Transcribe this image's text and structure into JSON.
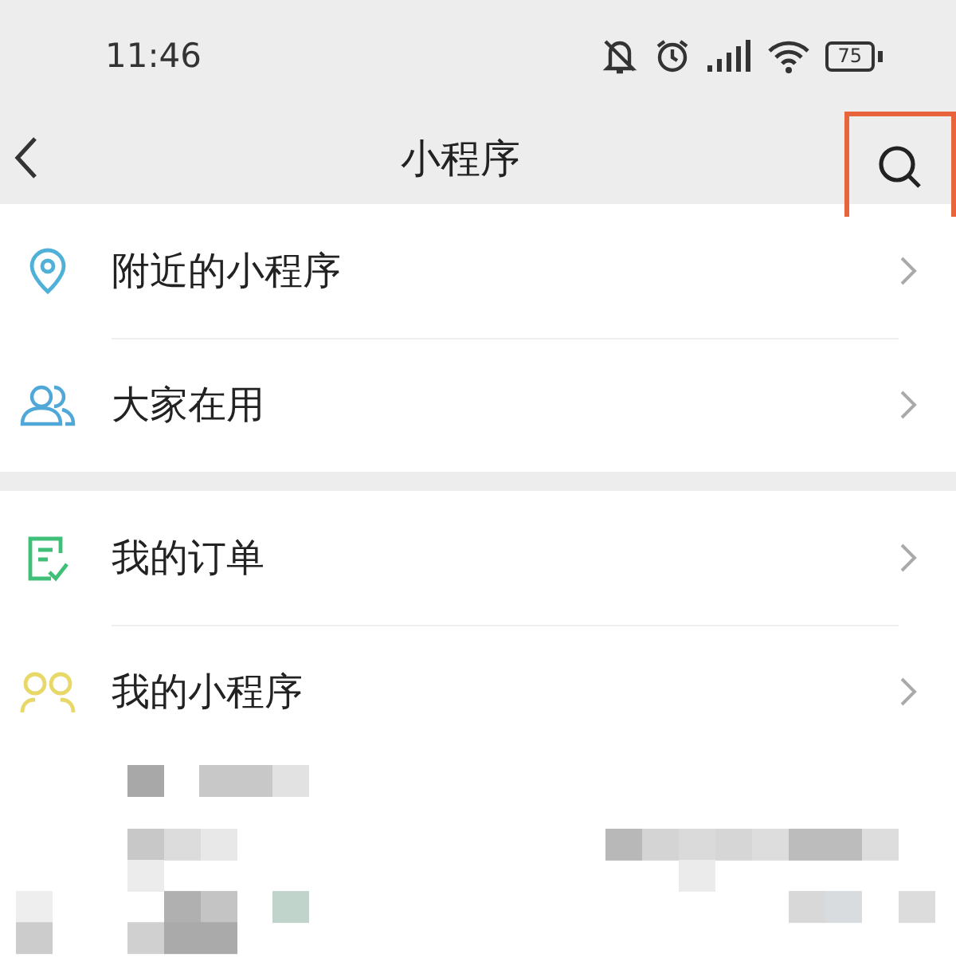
{
  "status_bar": {
    "time": "11:46",
    "battery": "75"
  },
  "nav_bar": {
    "title": "小程序",
    "search_highlighted": true
  },
  "sections": [
    {
      "items": [
        {
          "label": "附近的小程序"
        },
        {
          "label": "大家在用"
        }
      ]
    },
    {
      "items": [
        {
          "label": "我的订单"
        },
        {
          "label": "我的小程序"
        }
      ]
    }
  ]
}
